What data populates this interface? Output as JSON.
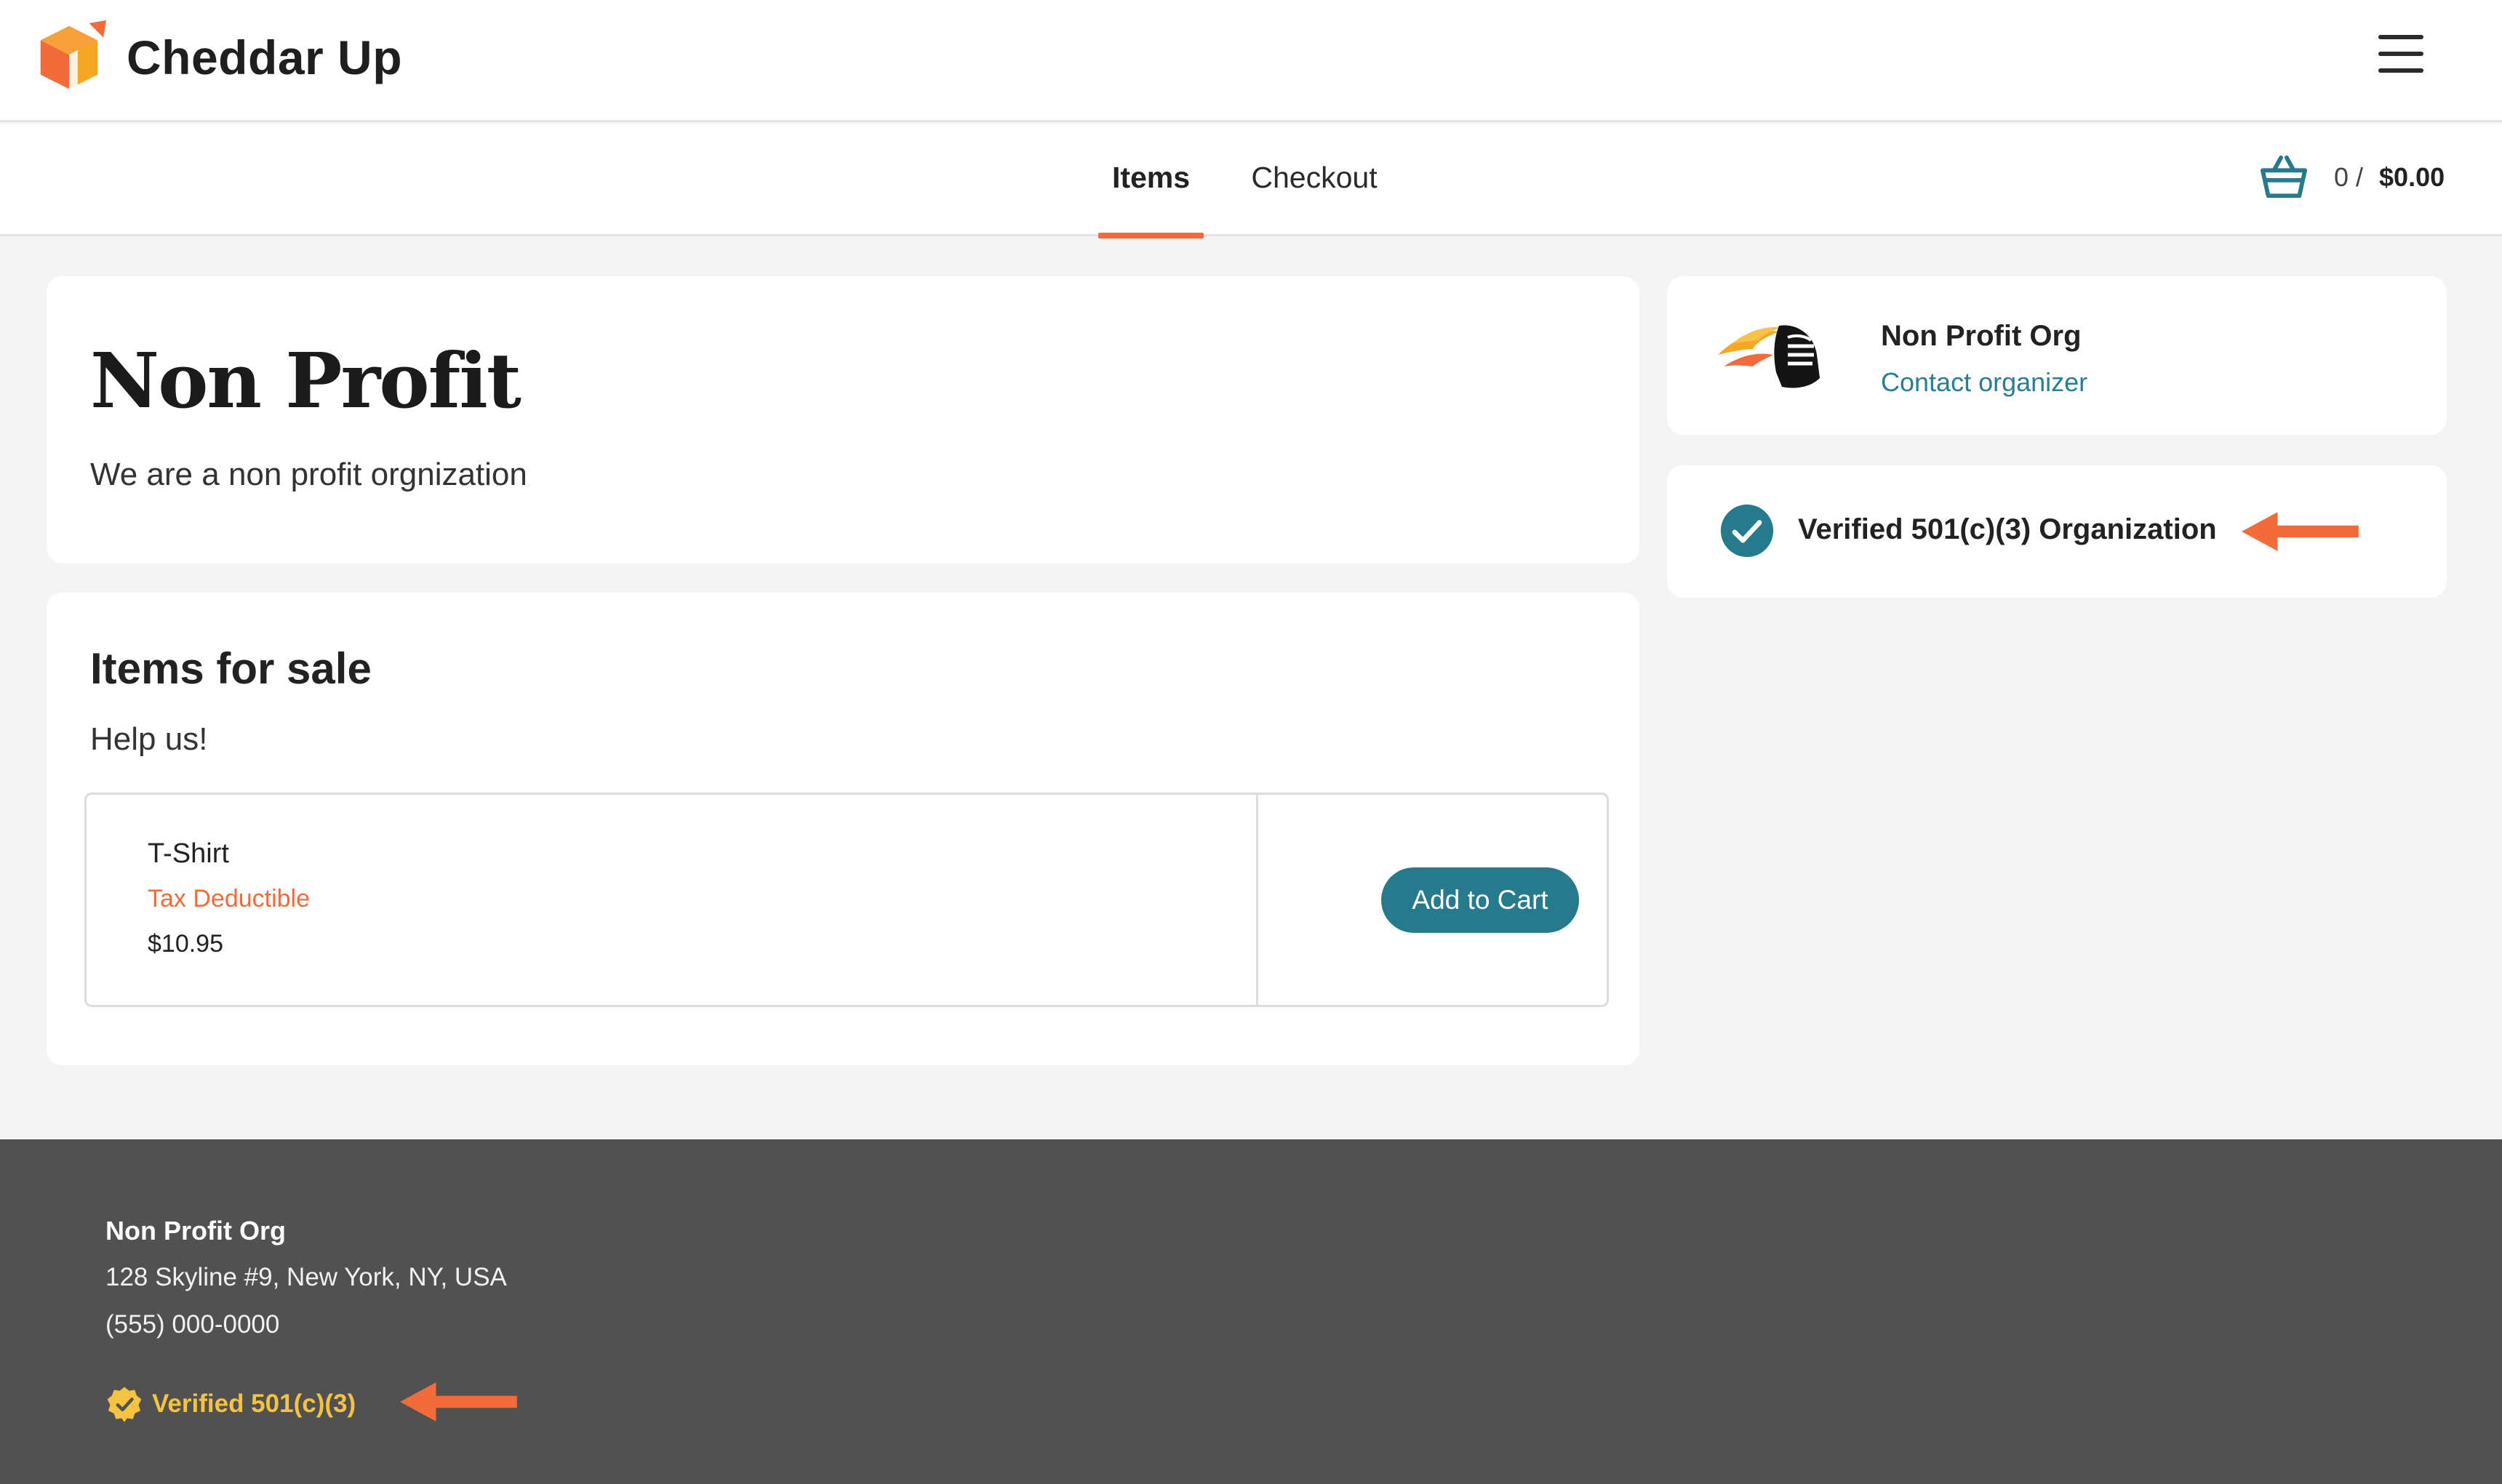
{
  "brand": {
    "name": "Cheddar Up",
    "logo_icon": "cheddar-up-box-logo",
    "accent": "#f26b3a"
  },
  "header": {
    "menu_icon": "hamburger-menu-icon"
  },
  "tabs": [
    {
      "label": "Items",
      "active": true
    },
    {
      "label": "Checkout",
      "active": false
    }
  ],
  "cart": {
    "icon": "basket-icon",
    "count": "0 /",
    "total": "$0.00"
  },
  "page": {
    "title": "Non Profit",
    "description": "We are a non profit orgnization"
  },
  "items_section": {
    "title": "Items for sale",
    "subtitle": "Help us!",
    "items": [
      {
        "name": "T-Shirt",
        "tag": "Tax Deductible",
        "price": "$10.95",
        "button": "Add to Cart"
      }
    ]
  },
  "organizer": {
    "name": "Non Profit Org",
    "contact_label": "Contact organizer",
    "logo_icon": "knight-helmet-logo"
  },
  "verification": {
    "label": "Verified 501(c)(3) Organization",
    "icon": "check-circle-icon",
    "check_color": "#277a8c"
  },
  "footer": {
    "org_name": "Non Profit Org",
    "address": "128 Skyline #9, New York, NY, USA",
    "phone": "(555) 000-0000",
    "badge_label": "Verified 501(c)(3)",
    "badge_icon": "verified-seal-icon",
    "badge_color": "#f5c342"
  },
  "annotations": {
    "arrow_color": "#f26b3a"
  }
}
